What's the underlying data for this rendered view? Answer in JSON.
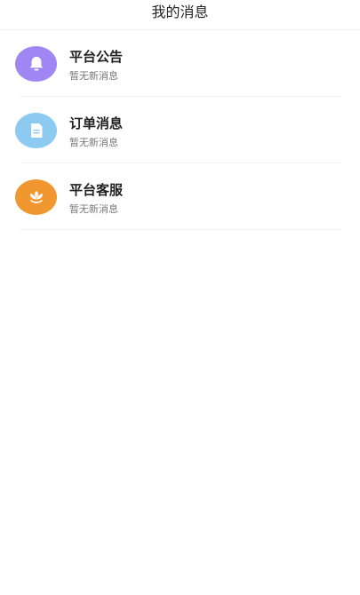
{
  "header": {
    "title": "我的消息"
  },
  "messages": [
    {
      "title": "平台公告",
      "subtitle": "暂无新消息",
      "icon": "bell-icon",
      "color": "#9f86f2"
    },
    {
      "title": "订单消息",
      "subtitle": "暂无新消息",
      "icon": "document-icon",
      "color": "#8ccaf1"
    },
    {
      "title": "平台客服",
      "subtitle": "暂无新消息",
      "icon": "flower-icon",
      "color": "#f0972f"
    }
  ]
}
